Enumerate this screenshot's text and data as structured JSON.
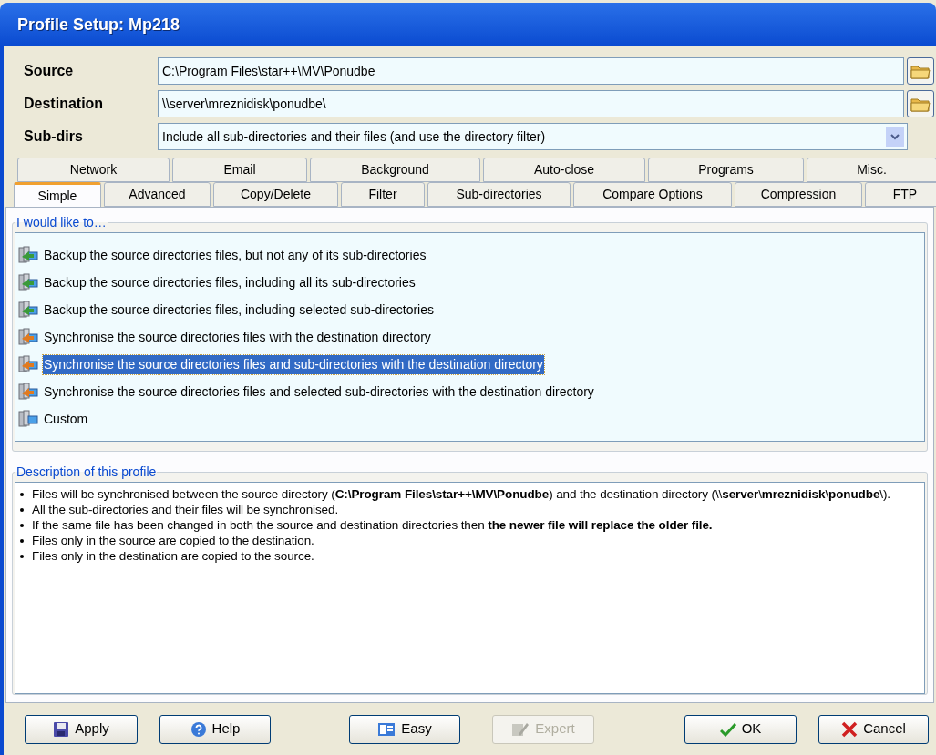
{
  "window": {
    "title": "Profile Setup: Mp218"
  },
  "fields": [
    {
      "kind": "text",
      "label": "Source",
      "value": "C:\\Program Files\\star++\\MV\\Ponudbe"
    },
    {
      "kind": "text",
      "label": "Destination",
      "value": "\\\\server\\mreznidisk\\ponudbe\\"
    },
    {
      "kind": "dropdown",
      "label": "Sub-dirs",
      "value": "Include all sub-directories and their files (and use the directory filter)"
    }
  ],
  "tab_rows": [
    [
      {
        "label": "Network",
        "selected": false
      },
      {
        "label": "Email",
        "selected": false
      },
      {
        "label": "Background",
        "selected": false
      },
      {
        "label": "Auto-close",
        "selected": false
      },
      {
        "label": "Programs",
        "selected": false
      },
      {
        "label": "Misc.",
        "selected": false
      }
    ],
    [
      {
        "label": "Simple",
        "selected": true
      },
      {
        "label": "Advanced",
        "selected": false
      },
      {
        "label": "Copy/Delete",
        "selected": false
      },
      {
        "label": "Filter",
        "selected": false
      },
      {
        "label": "Sub-directories",
        "selected": false
      },
      {
        "label": "Compare Options",
        "selected": false
      },
      {
        "label": "Compression",
        "selected": false
      },
      {
        "label": "FTP",
        "selected": false
      }
    ]
  ],
  "options_group": {
    "title": "I would like to…",
    "items": [
      {
        "kind": "backup",
        "label": "Backup the source directories files, but not any of its sub-directories",
        "selected": false
      },
      {
        "kind": "backup",
        "label": "Backup the source directories files, including all its sub-directories",
        "selected": false
      },
      {
        "kind": "backup",
        "label": "Backup the source directories files, including selected sub-directories",
        "selected": false
      },
      {
        "kind": "sync",
        "label": "Synchronise the source directories files with the destination directory",
        "selected": false
      },
      {
        "kind": "sync",
        "label": "Synchronise the source directories files and sub-directories with the destination directory",
        "selected": true
      },
      {
        "kind": "sync",
        "label": "Synchronise the source directories files and selected sub-directories with the destination directory",
        "selected": false
      },
      {
        "kind": "custom",
        "label": "Custom",
        "selected": false
      }
    ]
  },
  "description_group": {
    "title": "Description of this profile",
    "bullets": [
      "Files will be synchronised between the source directory (**C:\\Program Files\\star++\\MV\\Ponudbe**) and the destination directory (\\\\**server**\\**mreznidisk**\\**ponudbe**\\).",
      "All the sub-directories and their files will be synchronised.",
      "If the same file has been changed in both the source and destination directories then **the newer file will replace the older file.**",
      "Files only in the source are copied to the destination.",
      "Files only in the destination are copied to the source."
    ]
  },
  "buttons": [
    {
      "kind": "apply",
      "label": "Apply",
      "disabled": false
    },
    {
      "kind": "help",
      "label": "Help",
      "disabled": false
    },
    {
      "kind": "easy",
      "label": "Easy",
      "disabled": false
    },
    {
      "kind": "expert",
      "label": "Expert",
      "disabled": true
    },
    {
      "kind": "ok",
      "label": "OK",
      "disabled": false
    },
    {
      "kind": "cancel",
      "label": "Cancel",
      "disabled": false
    }
  ]
}
